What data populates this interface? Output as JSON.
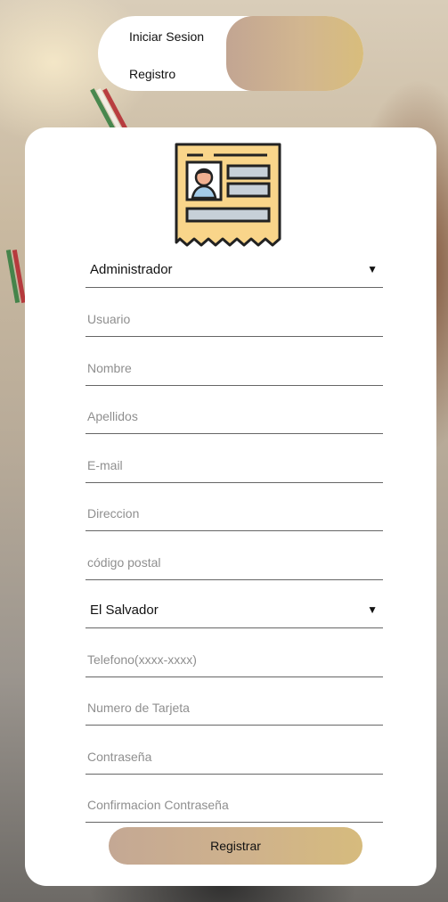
{
  "nav": {
    "login_label": "Iniciar Sesion",
    "register_label": "Registro"
  },
  "form": {
    "role_select": "Administrador",
    "fields": {
      "usuario": "Usuario",
      "nombre": "Nombre",
      "apellidos": "Apellidos",
      "email": "E-mail",
      "direccion": "Direccion",
      "codigo_postal": "código postal",
      "telefono": "Telefono(xxxx-xxxx)",
      "tarjeta": "Numero de Tarjeta",
      "contrasena": "Contraseña",
      "confirmacion": "Confirmacion Contraseña"
    },
    "country_select": "El Salvador",
    "submit_label": "Registrar"
  },
  "icons": {
    "header": "id-card-icon",
    "select_arrow": "caret-down-icon"
  },
  "colors": {
    "accent_gradient_start": "#c2a592",
    "accent_gradient_end": "#d8bd7c",
    "card_bg": "#ffffff",
    "id_card_fill": "#f9d58a"
  }
}
